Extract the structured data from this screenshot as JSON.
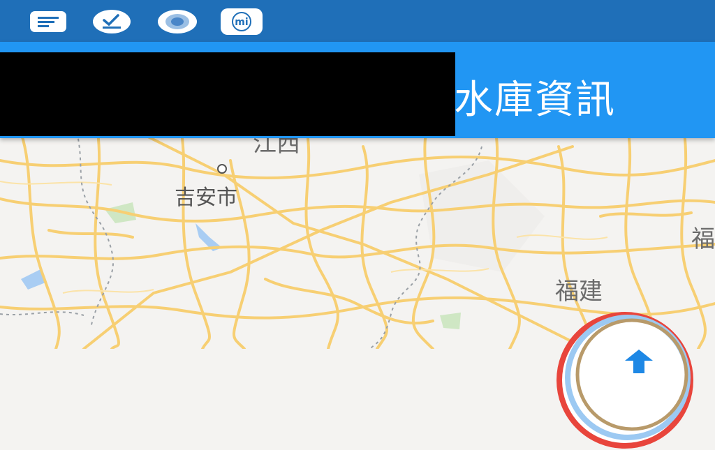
{
  "status_bar": {
    "icons": [
      "message-icon",
      "download-check-icon",
      "record-icon",
      "mi-app-icon"
    ],
    "mi_label": "mi"
  },
  "app_bar": {
    "title_visible": "水庫資訊",
    "accent_color": "#2196f3"
  },
  "map": {
    "labels": {
      "jiangxi": "江西",
      "jian_city": "吉安市",
      "fujian": "福建",
      "fu_edge": "福"
    }
  },
  "colors": {
    "status_bar": "#1f6fb8",
    "app_bar": "#2196f3",
    "road": "#f7cf73",
    "map_bg": "#f4f3f1"
  }
}
